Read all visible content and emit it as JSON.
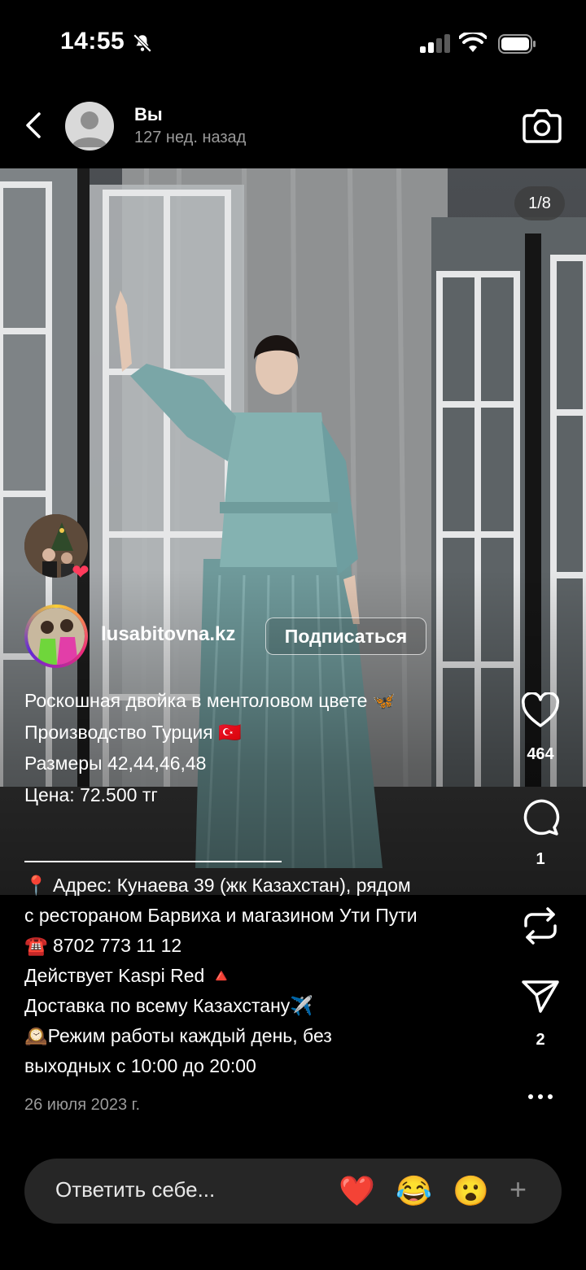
{
  "status": {
    "time": "14:55"
  },
  "header": {
    "name": "Вы",
    "subtitle": "127 нед. назад"
  },
  "media": {
    "counter": "1/8"
  },
  "author": {
    "username": "lusabitovna.kz",
    "follow_label": "Подписаться"
  },
  "caption": {
    "lines": [
      "Роскошная двойка в ментоловом цвете 🦋",
      "Производство Турция 🇹🇷",
      "Размеры 42,44,46,48",
      "Цена: 72.500 тг"
    ],
    "lines2": [
      "📍 Адрес: Кунаева 39 (жк Казахстан), рядом",
      "с рестораном Барвиха и магазином Ути Пути",
      "☎️ 8702 773 11 12",
      "Действует Kaspi Red 🔺",
      "Доставка по всему Казахстану✈️",
      "🕰️Режим работы каждый день, без",
      "выходных с 10:00 до 20:00"
    ],
    "date": "26 июля 2023 г."
  },
  "actions": {
    "likes": "464",
    "comments": "1",
    "shares": "2"
  },
  "reply": {
    "placeholder": "Ответить себе...",
    "emojis": [
      "❤️",
      "😂",
      "😮"
    ],
    "plus": "+"
  }
}
